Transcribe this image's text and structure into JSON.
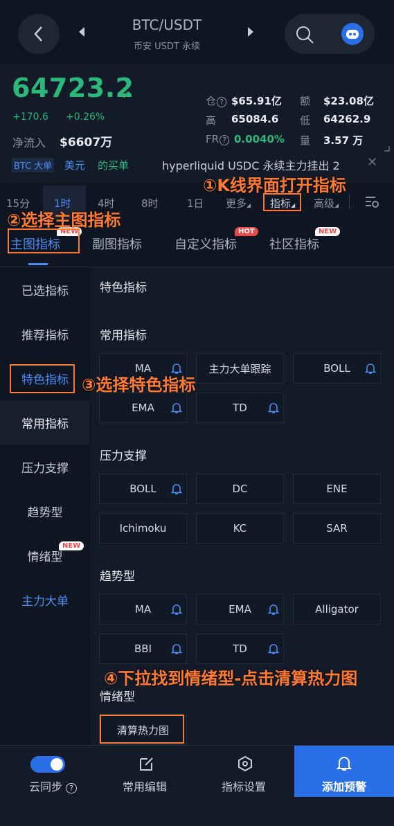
{
  "header": {
    "pair": "BTC/USDT",
    "subtitle": "币安 USDT 永续",
    "icons": [
      "back-arrow-icon",
      "prev-triangle-icon",
      "next-triangle-icon",
      "search-icon",
      "robot-avatar-icon"
    ]
  },
  "price": {
    "last": "64723.2",
    "change_abs": "+170.6",
    "change_pct": "+0.26%",
    "netflow_label": "净流入",
    "netflow_value": "$6607万",
    "stats": {
      "oi_label": "仓",
      "oi_value": "$65.91亿",
      "amount_label": "额",
      "amount_value": "$23.08亿",
      "high_label": "高",
      "high_value": "65084.6",
      "low_label": "低",
      "low_value": "64262.9",
      "fr_label": "FR",
      "fr_value": "0.0040%",
      "vol_label": "量",
      "vol_value": "3.57 万"
    },
    "colors": {
      "up": "#2bb87a",
      "accent": "#4d8cf5"
    }
  },
  "ticker": {
    "badge": "BTC 大单",
    "text1": "美元",
    "text2": "的买单",
    "news": "hyperliquid USDC 永续主力挂出 2"
  },
  "timeframes": {
    "items": [
      "15分",
      "1时",
      "4时",
      "8时",
      "1日",
      "更多",
      "指标",
      "高级"
    ],
    "active": "1时"
  },
  "tabs": {
    "items": [
      "主图指标",
      "副图指标",
      "自定义指标",
      "社区指标"
    ],
    "badges": {
      "main": "NEW",
      "custom": "HOT",
      "community": "NEW"
    }
  },
  "categories": {
    "items": [
      "已选指标",
      "推荐指标",
      "特色指标",
      "常用指标",
      "压力支撑",
      "趋势型",
      "情绪型",
      "主力大单"
    ],
    "badge_emotion": "NEW"
  },
  "content": {
    "featured_title": "特色指标",
    "common_title": "常用指标",
    "common": [
      "MA",
      "主力大单跟踪",
      "BOLL",
      "EMA",
      "TD"
    ],
    "support_title": "压力支撑",
    "support": [
      "BOLL",
      "DC",
      "ENE",
      "Ichimoku",
      "KC",
      "SAR"
    ],
    "trend_title": "趋势型",
    "trend": [
      "MA",
      "EMA",
      "Alligator",
      "BBI",
      "TD"
    ],
    "emotion_title": "情绪型",
    "emotion": [
      "清算热力图"
    ]
  },
  "bottombar": {
    "sync": "云同步",
    "edit": "常用编辑",
    "settings": "指标设置",
    "alert": "添加预警"
  },
  "annotations": {
    "step1": "①K线界面打开指标",
    "step2": "②选择主图指标",
    "step3": "③选择特色指标",
    "step4": "④下拉找到情绪型-点击清算热力图"
  }
}
